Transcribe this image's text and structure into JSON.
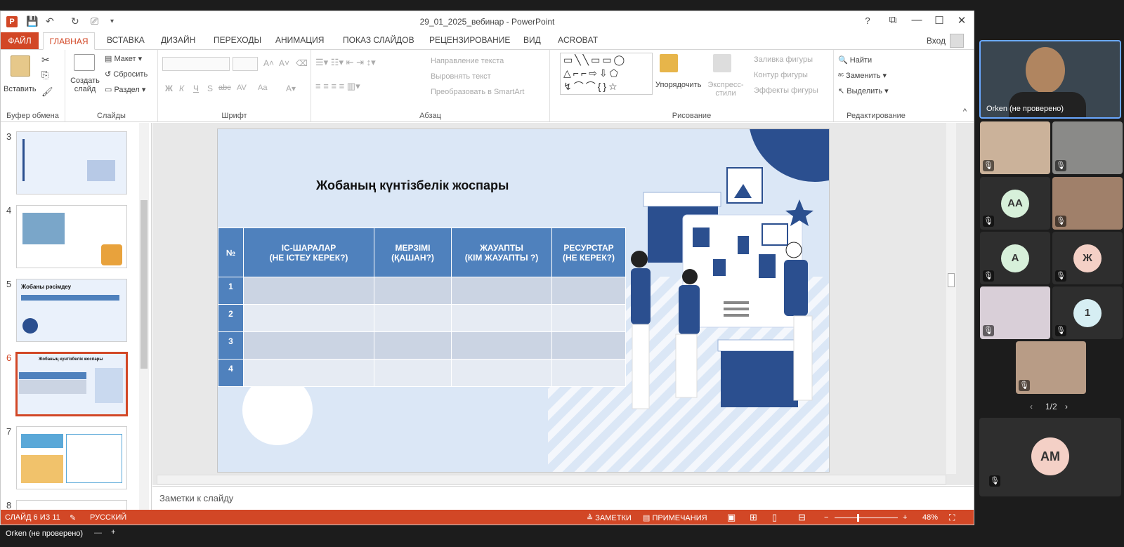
{
  "window": {
    "title": "29_01_2025_вебинар - PowerPoint",
    "help": "?",
    "signin": "Вход"
  },
  "tabs": [
    "ФАЙЛ",
    "ГЛАВНАЯ",
    "ВСТАВКА",
    "ДИЗАЙН",
    "ПЕРЕХОДЫ",
    "АНИМАЦИЯ",
    "ПОКАЗ СЛАЙДОВ",
    "РЕЦЕНЗИРОВАНИЕ",
    "ВИД",
    "ACROBAT"
  ],
  "ribbon": {
    "clipboard": {
      "paste": "Вставить",
      "label": "Буфер обмена"
    },
    "slides": {
      "new_slide": "Создать слайд",
      "layout": "Макет",
      "reset": "Сбросить",
      "section": "Раздел",
      "label": "Слайды"
    },
    "font": {
      "label": "Шрифт",
      "bold": "Ж",
      "italic": "К",
      "underline": "Ч",
      "strike": "S",
      "abc": "abc",
      "spacing": "AV",
      "case": "Aa"
    },
    "paragraph": {
      "text_direction": "Направление текста",
      "align_text": "Выровнять текст",
      "smartart": "Преобразовать в SmartArt",
      "label": "Абзац"
    },
    "drawing": {
      "arrange": "Упорядочить",
      "quick_styles": "Экспресс-стили",
      "shape_fill": "Заливка фигуры",
      "shape_outline": "Контур фигуры",
      "shape_effects": "Эффекты фигуры",
      "label": "Рисование"
    },
    "editing": {
      "find": "Найти",
      "replace": "Заменить",
      "select": "Выделить",
      "label": "Редактирование"
    }
  },
  "thumbnails": [
    {
      "num": "3"
    },
    {
      "num": "4"
    },
    {
      "num": "5",
      "title": "Жобаны рәсімдеу"
    },
    {
      "num": "6",
      "title": "Жобаның күнтізбелік жоспары"
    },
    {
      "num": "7"
    },
    {
      "num": "8"
    }
  ],
  "slide": {
    "title": "Жобаның күнтізбелік жоспары",
    "table": {
      "headers": [
        "№",
        "ІС-ШАРАЛАР\n(НЕ ІСТЕУ КЕРЕК?)",
        "МЕРЗІМІ\n(ҚАШАН?)",
        "ЖАУАПТЫ\n(КІМ ЖАУАПТЫ ?)",
        "РЕСУРСТАР\n(НЕ КЕРЕК?)"
      ],
      "rows": [
        "1",
        "2",
        "3",
        "4"
      ]
    }
  },
  "notes": {
    "placeholder": "Заметки к слайду"
  },
  "status": {
    "slide": "СЛАЙД 6 ИЗ 11",
    "language": "РУССКИЙ",
    "notes": "ЗАМЕТКИ",
    "comments": "ПРИМЕЧАНИЯ",
    "zoom": "48%"
  },
  "meeting": {
    "active_speaker": "Orken (не проверено)",
    "participants": [
      "AA",
      "A",
      "Ж",
      "1",
      "AM"
    ],
    "page": "1/2",
    "self_name": "Orken (не проверено)"
  },
  "colors": {
    "accent": "#d24726",
    "table_header": "#4f81bd",
    "navy": "#2b4f8f"
  }
}
